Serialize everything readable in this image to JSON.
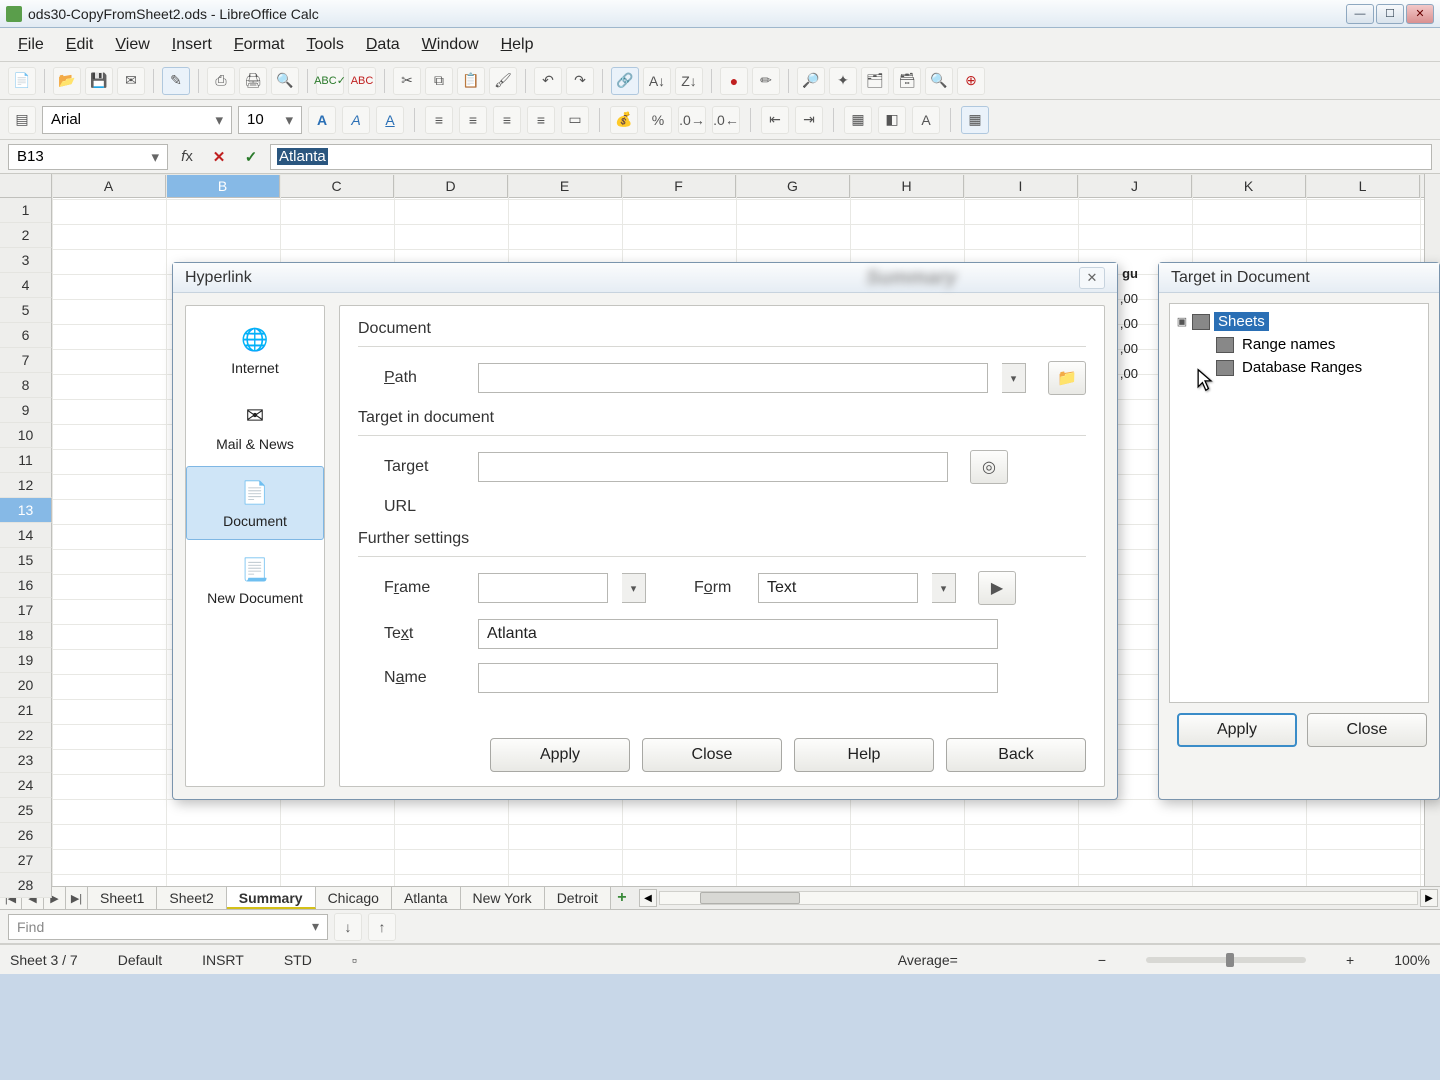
{
  "window": {
    "title": "ods30-CopyFromSheet2.ods - LibreOffice Calc"
  },
  "menus": [
    "File",
    "Edit",
    "View",
    "Insert",
    "Format",
    "Tools",
    "Data",
    "Window",
    "Help"
  ],
  "font": {
    "name": "Arial",
    "size": "10"
  },
  "namebox": "B13",
  "formula": "Atlanta",
  "columns": [
    "A",
    "B",
    "C",
    "D",
    "E",
    "F",
    "G",
    "H",
    "I",
    "J",
    "K",
    "L"
  ],
  "active_col_index": 1,
  "row_count": 28,
  "active_row": 13,
  "peek_cells": {
    "J4_partial": "gu",
    "J5": ",00",
    "J6": ",00",
    "J7": ",00",
    "J8": ",00"
  },
  "tabs": {
    "nav": [
      "|◀",
      "◀",
      "▶",
      "▶|"
    ],
    "sheets": [
      "Sheet1",
      "Sheet2",
      "Summary",
      "Chicago",
      "Atlanta",
      "New York",
      "Detroit"
    ],
    "active_index": 2
  },
  "findbar": {
    "placeholder": "Find"
  },
  "status": {
    "sheet": "Sheet 3 / 7",
    "style": "Default",
    "insert": "INSRT",
    "std": "STD",
    "avg": "Average=",
    "zoom": "100%"
  },
  "hyperlink_dialog": {
    "title": "Hyperlink",
    "blurred_bg": "Summary",
    "categories": [
      {
        "label": "Internet",
        "icon": "🌐"
      },
      {
        "label": "Mail & News",
        "icon": "✉"
      },
      {
        "label": "Document",
        "icon": "📄",
        "selected": true
      },
      {
        "label": "New Document",
        "icon": "📃"
      }
    ],
    "groups": {
      "document": "Document",
      "target": "Target in document",
      "further": "Further settings"
    },
    "fields": {
      "path_label": "Path",
      "path_value": "",
      "target_label": "Target",
      "target_value": "",
      "url_label": "URL",
      "frame_label": "Frame",
      "frame_value": "",
      "form_label": "Form",
      "form_value": "Text",
      "text_label": "Text",
      "text_value": "Atlanta",
      "name_label": "Name",
      "name_value": ""
    },
    "buttons": {
      "apply": "Apply",
      "close": "Close",
      "help": "Help",
      "back": "Back"
    }
  },
  "target_dialog": {
    "title": "Target in Document",
    "tree": [
      {
        "label": "Sheets",
        "selected": true,
        "expandable": true
      },
      {
        "label": "Range names",
        "child": true
      },
      {
        "label": "Database Ranges",
        "child": true
      }
    ],
    "buttons": {
      "apply": "Apply",
      "close": "Close"
    }
  }
}
